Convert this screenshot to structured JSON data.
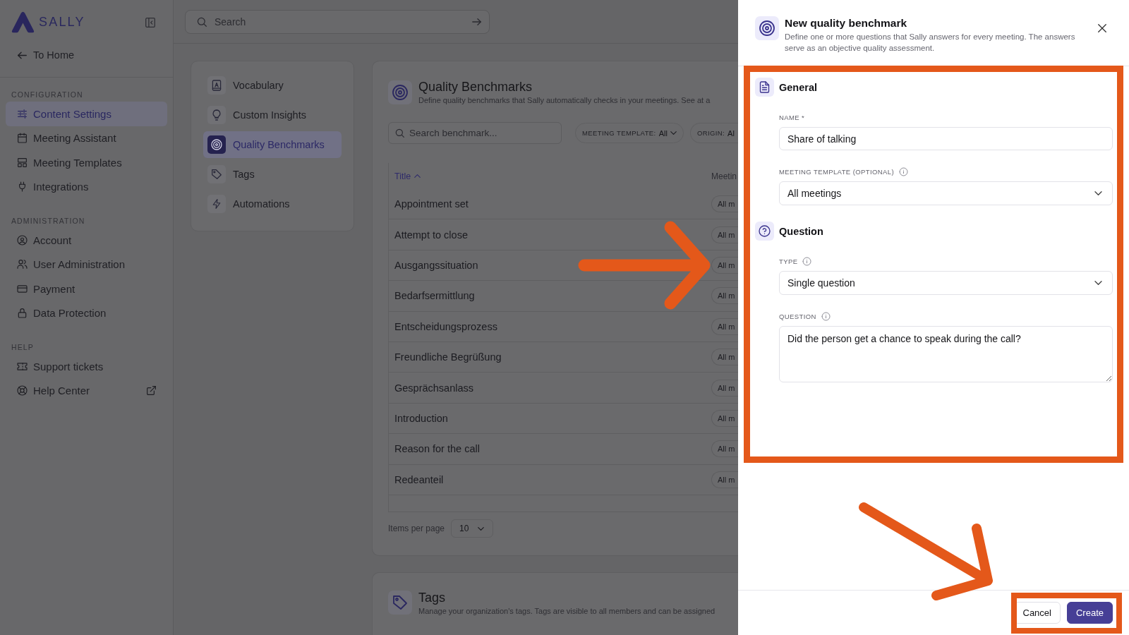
{
  "sidebar": {
    "logo": "SALLY",
    "back_link": "To Home",
    "sections": [
      {
        "heading": "CONFIGURATION",
        "items": [
          {
            "label": "Content Settings",
            "selected": true,
            "external": false
          },
          {
            "label": "Meeting Assistant",
            "selected": false,
            "external": false
          },
          {
            "label": "Meeting Templates",
            "selected": false,
            "external": false
          },
          {
            "label": "Integrations",
            "selected": false,
            "external": false
          }
        ]
      },
      {
        "heading": "ADMINISTRATION",
        "items": [
          {
            "label": "Account",
            "selected": false,
            "external": false
          },
          {
            "label": "User Administration",
            "selected": false,
            "external": false
          },
          {
            "label": "Payment",
            "selected": false,
            "external": false
          },
          {
            "label": "Data Protection",
            "selected": false,
            "external": false
          }
        ]
      },
      {
        "heading": "HELP",
        "items": [
          {
            "label": "Support tickets",
            "selected": false,
            "external": false
          },
          {
            "label": "Help Center",
            "selected": false,
            "external": true
          }
        ]
      }
    ]
  },
  "search": {
    "placeholder": "Search"
  },
  "settings_nav": {
    "items": [
      {
        "label": "Vocabulary",
        "selected": false
      },
      {
        "label": "Custom Insights",
        "selected": false
      },
      {
        "label": "Quality Benchmarks",
        "selected": true
      },
      {
        "label": "Tags",
        "selected": false
      },
      {
        "label": "Automations",
        "selected": false
      }
    ]
  },
  "benchmarks": {
    "title": "Quality Benchmarks",
    "description": "Define quality benchmarks that Sally automatically checks in your meetings. See at a",
    "search": {
      "placeholder": "Search benchmark..."
    },
    "filters": [
      {
        "label": "MEETING TEMPLATE:",
        "value": "All"
      },
      {
        "label": "ORIGIN:",
        "value": "Al"
      }
    ],
    "table": {
      "columns": [
        {
          "label": "Title",
          "sorted": true
        },
        {
          "label": "Meetin",
          "sorted": false
        }
      ],
      "rows": [
        {
          "title": "Appointment set",
          "template": "All m"
        },
        {
          "title": "Attempt to close",
          "template": "All m"
        },
        {
          "title": "Ausgangssituation",
          "template": "All m"
        },
        {
          "title": "Bedarfsermittlung",
          "template": "All m"
        },
        {
          "title": "Entscheidungsprozess",
          "template": "All m"
        },
        {
          "title": "Freundliche Begrüßung",
          "template": "All m"
        },
        {
          "title": "Gesprächsanlass",
          "template": "All m"
        },
        {
          "title": "Introduction",
          "template": "All m"
        },
        {
          "title": "Reason for the call",
          "template": "All m"
        },
        {
          "title": "Redeanteil",
          "template": "All m"
        }
      ]
    },
    "pagination": {
      "label": "Items per page",
      "value": "10"
    }
  },
  "tags_section": {
    "title": "Tags",
    "description": "Manage your organization's tags. Tags are visible to all members and can be assigned"
  },
  "drawer": {
    "title": "New quality benchmark",
    "description": "Define one or more questions that Sally answers for every meeting. The answers serve as an objective quality assessment.",
    "sections": [
      {
        "title": "General",
        "fields": [
          {
            "kind": "text",
            "label": "NAME *",
            "info": false,
            "value": "Share of talking"
          },
          {
            "kind": "select",
            "label": "MEETING TEMPLATE (OPTIONAL)",
            "info": true,
            "value": "All meetings"
          }
        ]
      },
      {
        "title": "Question",
        "fields": [
          {
            "kind": "select",
            "label": "TYPE",
            "info": true,
            "value": "Single question"
          },
          {
            "kind": "textarea",
            "label": "QUESTION",
            "info": true,
            "value": "Did the person get a chance to speak during the call?"
          }
        ]
      }
    ],
    "buttons": [
      {
        "label": "Cancel",
        "kind": "secondary"
      },
      {
        "label": "Create",
        "kind": "primary"
      }
    ]
  }
}
